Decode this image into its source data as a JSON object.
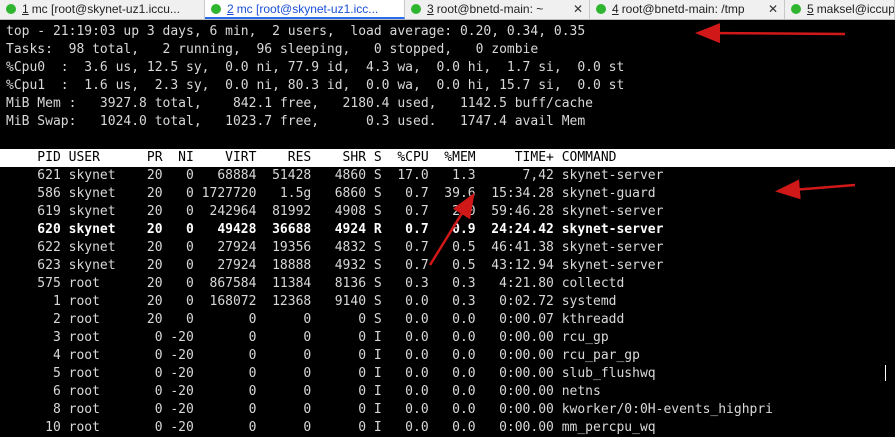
{
  "tabs": [
    {
      "num": "1",
      "label": "mc [root@skynet-uz1.iccu...",
      "active": false
    },
    {
      "num": "2",
      "label": "mc [root@skynet-uz1.icc...",
      "active": true
    },
    {
      "num": "3",
      "label": "root@bnetd-main: ~",
      "active": false
    },
    {
      "num": "4",
      "label": "root@bnetd-main: /tmp",
      "active": false
    },
    {
      "num": "5",
      "label": "maksel@iccup",
      "active": false
    }
  ],
  "summary": [
    "top - 21:19:03 up 3 days, 6 min,  2 users,  load average: 0.20, 0.34, 0.35",
    "Tasks:  98 total,   2 running,  96 sleeping,   0 stopped,   0 zombie",
    "%Cpu0  :  3.6 us, 12.5 sy,  0.0 ni, 77.9 id,  4.3 wa,  0.0 hi,  1.7 si,  0.0 st",
    "%Cpu1  :  1.6 us,  2.3 sy,  0.0 ni, 80.3 id,  0.0 wa,  0.0 hi, 15.7 si,  0.0 st",
    "MiB Mem :   3927.8 total,    842.1 free,   2180.4 used,   1142.5 buff/cache",
    "MiB Swap:   1024.0 total,   1023.7 free,      0.3 used.   1747.4 avail Mem"
  ],
  "columns_header": "    PID USER      PR  NI    VIRT    RES    SHR S  %CPU  %MEM     TIME+ COMMAND",
  "processes": [
    {
      "text": "    621 skynet    20   0   68884  51428   4860 S  17.0   1.3      7,42 skynet-server",
      "bold": false
    },
    {
      "text": "    586 skynet    20   0 1727720   1.5g   6860 S   0.7  39.6  15:34.28 skynet-guard",
      "bold": false
    },
    {
      "text": "    619 skynet    20   0  242964  81992   4908 S   0.7   2.0  59:46.28 skynet-server",
      "bold": false
    },
    {
      "text": "    620 skynet    20   0   49428  36688   4924 R   0.7   0.9  24:24.42 skynet-server",
      "bold": true
    },
    {
      "text": "    622 skynet    20   0   27924  19356   4832 S   0.7   0.5  46:41.38 skynet-server",
      "bold": false
    },
    {
      "text": "    623 skynet    20   0   27924  18888   4932 S   0.7   0.5  43:12.94 skynet-server",
      "bold": false
    },
    {
      "text": "    575 root      20   0  867584  11384   8136 S   0.3   0.3   4:21.80 collectd",
      "bold": false
    },
    {
      "text": "      1 root      20   0  168072  12368   9140 S   0.0   0.3   0:02.72 systemd",
      "bold": false
    },
    {
      "text": "      2 root      20   0       0      0      0 S   0.0   0.0   0:00.07 kthreadd",
      "bold": false
    },
    {
      "text": "      3 root       0 -20       0      0      0 I   0.0   0.0   0:00.00 rcu_gp",
      "bold": false
    },
    {
      "text": "      4 root       0 -20       0      0      0 I   0.0   0.0   0:00.00 rcu_par_gp",
      "bold": false
    },
    {
      "text": "      5 root       0 -20       0      0      0 I   0.0   0.0   0:00.00 slub_flushwq",
      "bold": false
    },
    {
      "text": "      6 root       0 -20       0      0      0 I   0.0   0.0   0:00.00 netns",
      "bold": false
    },
    {
      "text": "      8 root       0 -20       0      0      0 I   0.0   0.0   0:00.00 kworker/0:0H-events_highpri",
      "bold": false
    },
    {
      "text": "     10 root       0 -20       0      0      0 I   0.0   0.0   0:00.00 mm_percpu_wq",
      "bold": false
    }
  ],
  "colors": {
    "annotation_arrow": "#d01818",
    "active_tab": "#1a4fd6",
    "terminal_bg": "#000000",
    "terminal_fg": "#d8d8d8"
  }
}
